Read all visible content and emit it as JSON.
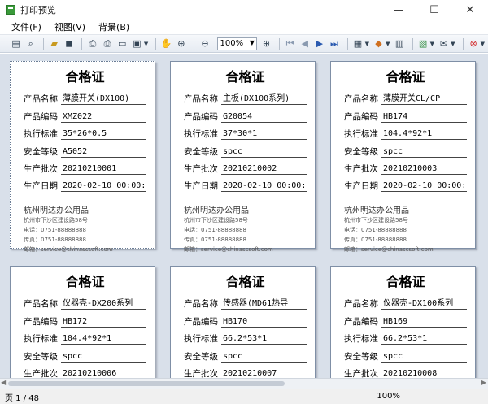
{
  "window": {
    "title": "打印预览",
    "minimize": "—",
    "maximize": "☐",
    "close": "✕"
  },
  "menu": [
    {
      "label": "文件(F)"
    },
    {
      "label": "视图(V)"
    },
    {
      "label": "背景(B)"
    }
  ],
  "toolbar": {
    "zoom_value": "100%"
  },
  "labels": {
    "title": "合格证",
    "product_name": "产品名称",
    "product_code": "产品编码",
    "standard": "执行标准",
    "safety": "安全等级",
    "batch": "生产批次",
    "date": "生产日期"
  },
  "company": {
    "name": "杭州明达办公用品",
    "address": "杭州市下沙区建设路58号",
    "phone": "电话：0751-88888888",
    "fax": "传真：0751-88888888",
    "email": "邮箱：service@chinascsoft.com"
  },
  "cards": [
    {
      "name": "薄膜开关(DX100)",
      "code": "XMZ022",
      "standard": "35*26*0.5",
      "safety": "A5052",
      "batch": "20210210001",
      "date": "2020-02-10 00:00:"
    },
    {
      "name": "主板(DX100系列)",
      "code": "G20054",
      "standard": "37*30*1",
      "safety": "spcc",
      "batch": "20210210002",
      "date": "2020-02-10 00:00:"
    },
    {
      "name": "薄膜开关CL/CP",
      "code": "HB174",
      "standard": "104.4*92*1",
      "safety": "spcc",
      "batch": "20210210003",
      "date": "2020-02-10 00:00:"
    },
    {
      "name": "仪器壳-DX200系列",
      "code": "HB172",
      "standard": "104.4*92*1",
      "safety": "spcc",
      "batch": "20210210006"
    },
    {
      "name": "传感器(MD61热导",
      "code": "HB170",
      "standard": "66.2*53*1",
      "safety": "spcc",
      "batch": "20210210007"
    },
    {
      "name": "仪器壳-DX100系列",
      "code": "HB169",
      "standard": "66.2*53*1",
      "safety": "spcc",
      "batch": "20210210008"
    }
  ],
  "status": {
    "page": "页 1 / 48",
    "zoom": "100%"
  }
}
